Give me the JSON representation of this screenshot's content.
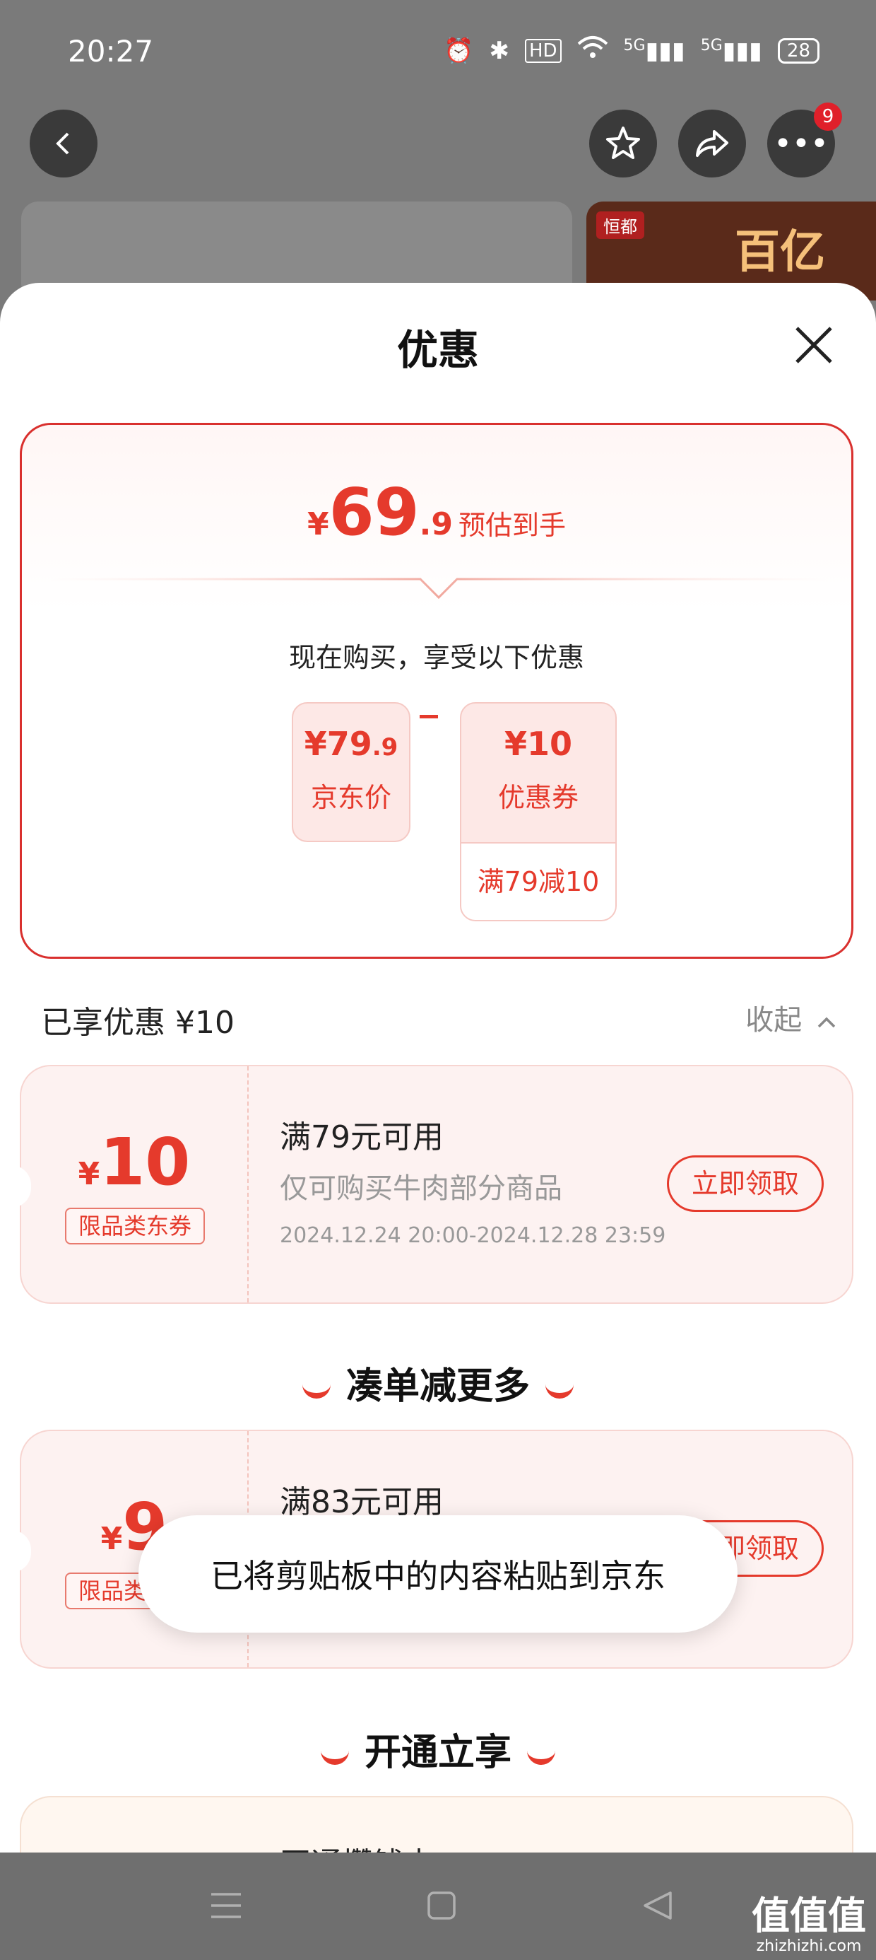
{
  "status_bar": {
    "time": "20:27",
    "hd": "HD",
    "net1": "5G",
    "net2": "5G",
    "battery": "28"
  },
  "top_bar": {
    "badge_count": "9"
  },
  "background_card": {
    "logo_text": "恒都",
    "promo_text": "百亿"
  },
  "sheet": {
    "title": "优惠",
    "summary": {
      "currency": "¥",
      "price_int": "69",
      "price_dec": ".9",
      "price_label": "预估到手",
      "buy_now_text": "现在购买，享受以下优惠",
      "jd_price_int": "¥79",
      "jd_price_dec": ".9",
      "jd_price_label": "京东价",
      "coupon_value": "¥10",
      "coupon_label": "优惠券",
      "coupon_rule": "满79减10"
    },
    "enjoyed_label": "已享优惠 ¥10",
    "collapse_label": "收起",
    "coupons": [
      {
        "currency": "¥",
        "amount": "10",
        "tag": "限品类东券",
        "condition": "满79元可用",
        "description": "仅可购买牛肉部分商品",
        "date_range": "2024.12.24 20:00-2024.12.28 23:59",
        "button": "立即领取"
      },
      {
        "currency": "¥",
        "amount": "9",
        "tag": "限品类东券",
        "condition": "满83元可用",
        "button": "立即领取"
      }
    ],
    "section_more": "凑单减更多",
    "section_open": "开通立享",
    "third_coupon_condition": "开通攒钱卡"
  },
  "toast": {
    "text": "已将剪贴板中的内容粘贴到京东"
  },
  "watermark": {
    "line1": "值值值",
    "line2": "zhizhizhi.com"
  },
  "icons": [
    "back-icon",
    "star-icon",
    "share-icon",
    "more-icon",
    "close-icon",
    "chevron-up-icon",
    "menu-icon",
    "home-icon",
    "back-triangle-icon"
  ],
  "colors": {
    "accent": "#e53a2c",
    "toast_bg": "#ffffff",
    "overlay": "#7a7a7a"
  }
}
